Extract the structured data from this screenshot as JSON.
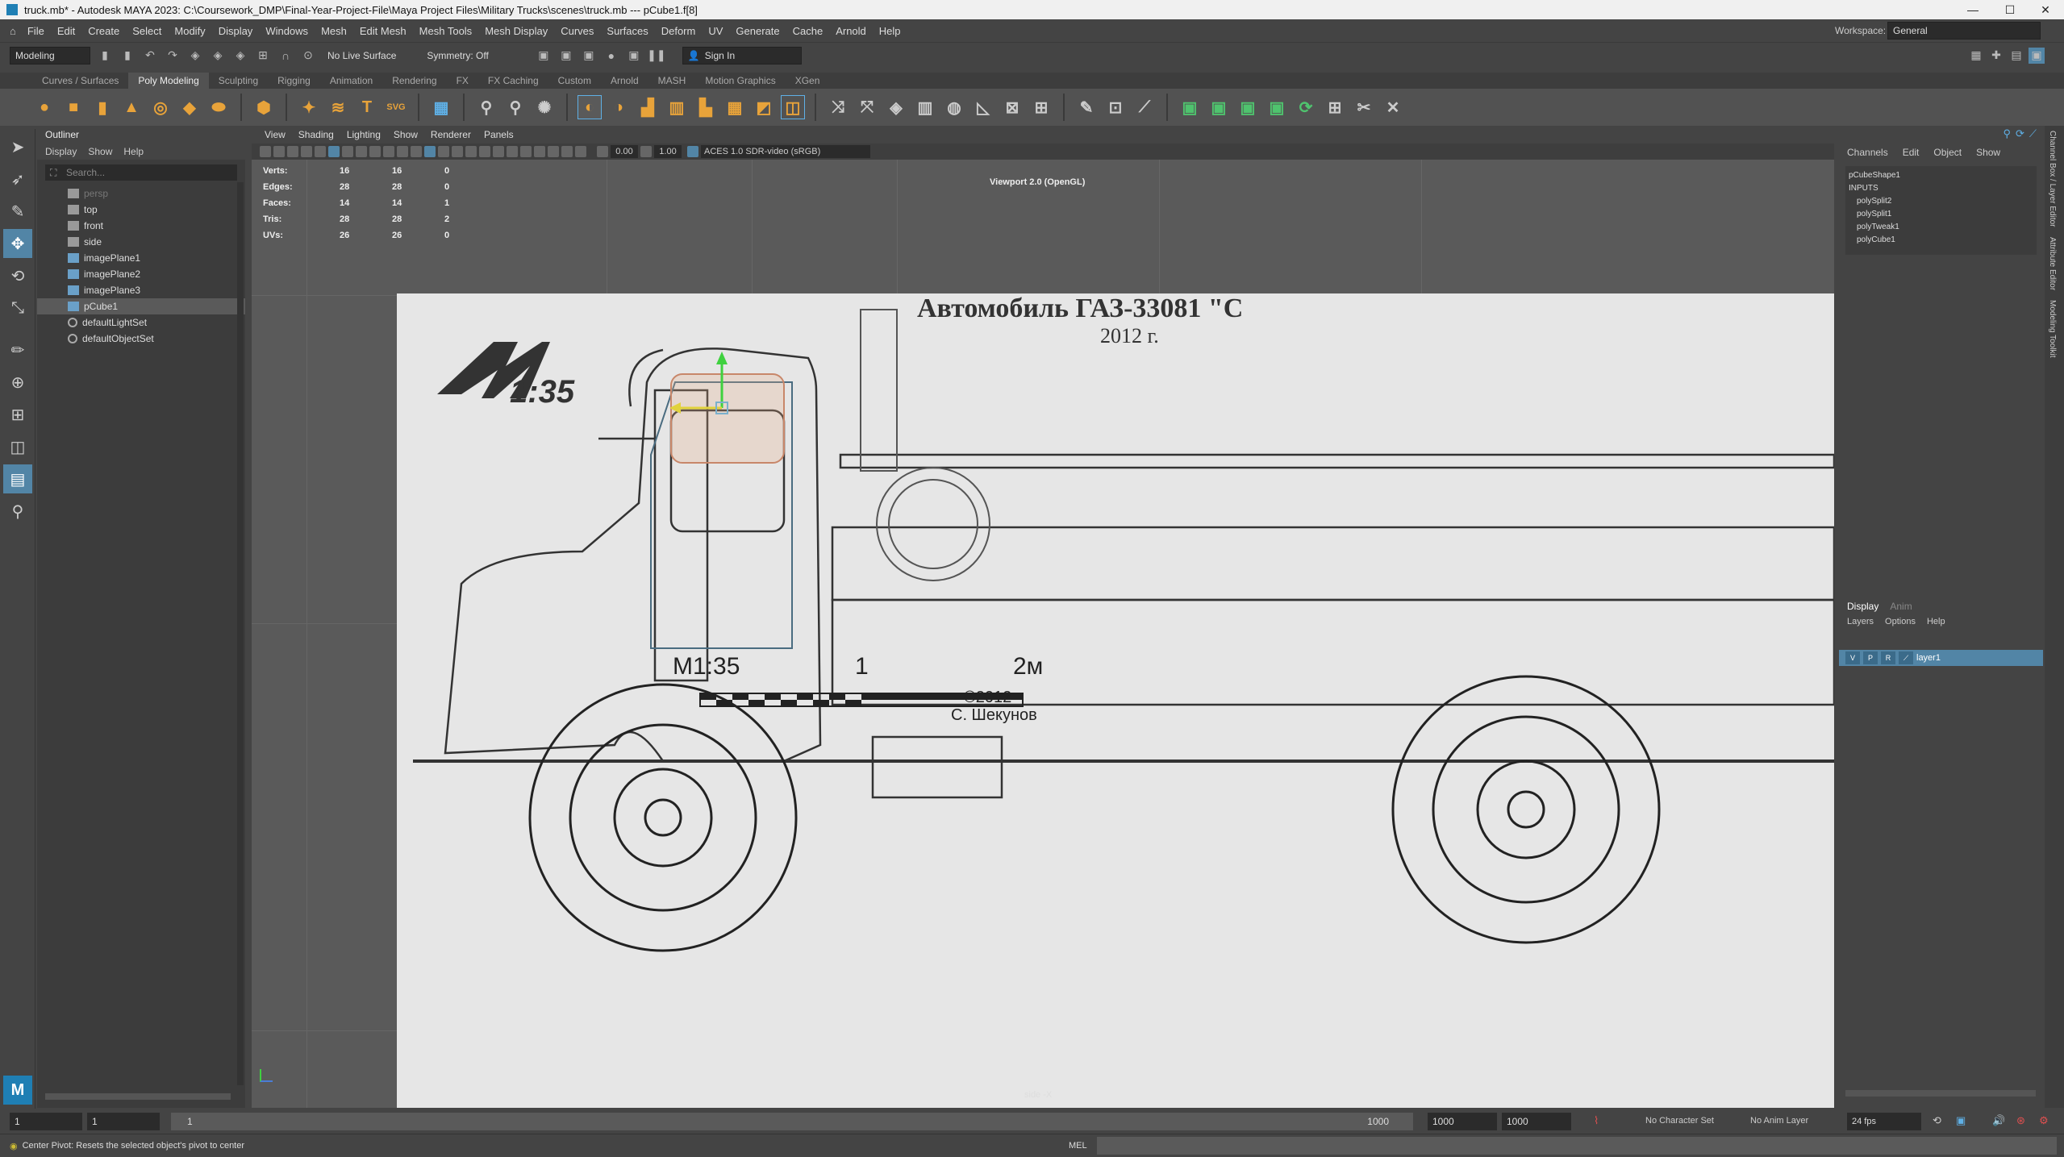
{
  "window": {
    "title": "truck.mb* - Autodesk MAYA 2023: C:\\Coursework_DMP\\Final-Year-Project-File\\Maya Project Files\\Military Trucks\\scenes\\truck.mb  ---  pCube1.f[8]"
  },
  "menubar": {
    "items": [
      "File",
      "Edit",
      "Create",
      "Select",
      "Modify",
      "Display",
      "Windows",
      "Mesh",
      "Edit Mesh",
      "Mesh Tools",
      "Mesh Display",
      "Curves",
      "Surfaces",
      "Deform",
      "UV",
      "Generate",
      "Cache",
      "Arnold",
      "Help"
    ],
    "workspace_label": "Workspace:",
    "workspace_value": "General"
  },
  "statusline": {
    "mode": "Modeling",
    "live_surface": "No Live Surface",
    "symmetry": "Symmetry: Off",
    "sign_in": "Sign In"
  },
  "shelf": {
    "tabs": [
      "Curves / Surfaces",
      "Poly Modeling",
      "Sculpting",
      "Rigging",
      "Animation",
      "Rendering",
      "FX",
      "FX Caching",
      "Custom",
      "Arnold",
      "MASH",
      "Motion Graphics",
      "XGen"
    ],
    "active_tab": "Poly Modeling"
  },
  "outliner": {
    "title": "Outliner",
    "menu": [
      "Display",
      "Show",
      "Help"
    ],
    "search_placeholder": "Search...",
    "items": [
      {
        "label": "persp",
        "dim": true
      },
      {
        "label": "top"
      },
      {
        "label": "front"
      },
      {
        "label": "side"
      },
      {
        "label": "imagePlane1"
      },
      {
        "label": "imagePlane2"
      },
      {
        "label": "imagePlane3"
      },
      {
        "label": "pCube1",
        "selected": true
      },
      {
        "label": "defaultLightSet"
      },
      {
        "label": "defaultObjectSet"
      }
    ]
  },
  "viewport": {
    "menu": [
      "View",
      "Shading",
      "Lighting",
      "Show",
      "Renderer",
      "Panels"
    ],
    "exposure": "0.00",
    "gamma": "1.00",
    "color_space": "ACES 1.0 SDR-video (sRGB)",
    "renderer_label": "Viewport 2.0 (OpenGL)",
    "camera_label": "side -X",
    "hud": [
      {
        "label": "Verts:",
        "a": "16",
        "b": "16",
        "c": "0"
      },
      {
        "label": "Edges:",
        "a": "28",
        "b": "28",
        "c": "0"
      },
      {
        "label": "Faces:",
        "a": "14",
        "b": "14",
        "c": "1"
      },
      {
        "label": "Tris:",
        "a": "28",
        "b": "28",
        "c": "2"
      },
      {
        "label": "UVs:",
        "a": "26",
        "b": "26",
        "c": "0"
      }
    ]
  },
  "blueprint": {
    "title": "Автомобиль ГАЗ-33081 \"С",
    "year": "2012 г.",
    "logo_scale": "1:35",
    "scale_label": "M1:35",
    "scale_1": "1",
    "scale_2": "2м",
    "copyright": "©2012",
    "author": "С. Шекунов"
  },
  "channelbox": {
    "menu": [
      "Channels",
      "Edit",
      "Object",
      "Show"
    ],
    "items": [
      "pCubeShape1",
      "INPUTS",
      "polySplit2",
      "polySplit1",
      "polyTweak1",
      "polyCube1"
    ]
  },
  "layers": {
    "tabs": [
      "Display",
      "Anim"
    ],
    "menu": [
      "Layers",
      "Options",
      "Help"
    ],
    "layer_name": "layer1",
    "v": "V",
    "p": "P",
    "r": "R"
  },
  "sidetabs": [
    "Channel Box / Layer Editor",
    "Attribute Editor",
    "Modeling Toolkit"
  ],
  "timeline": {
    "start": "1",
    "current": "1",
    "frame_marker": "1",
    "end_a": "1000",
    "end_b": "1000",
    "end_c": "1000",
    "character_set": "No Character Set",
    "anim_layer": "No Anim Layer",
    "fps": "24 fps"
  },
  "helpline": {
    "text": "Center Pivot: Resets the selected object's pivot to center",
    "mel": "MEL"
  }
}
